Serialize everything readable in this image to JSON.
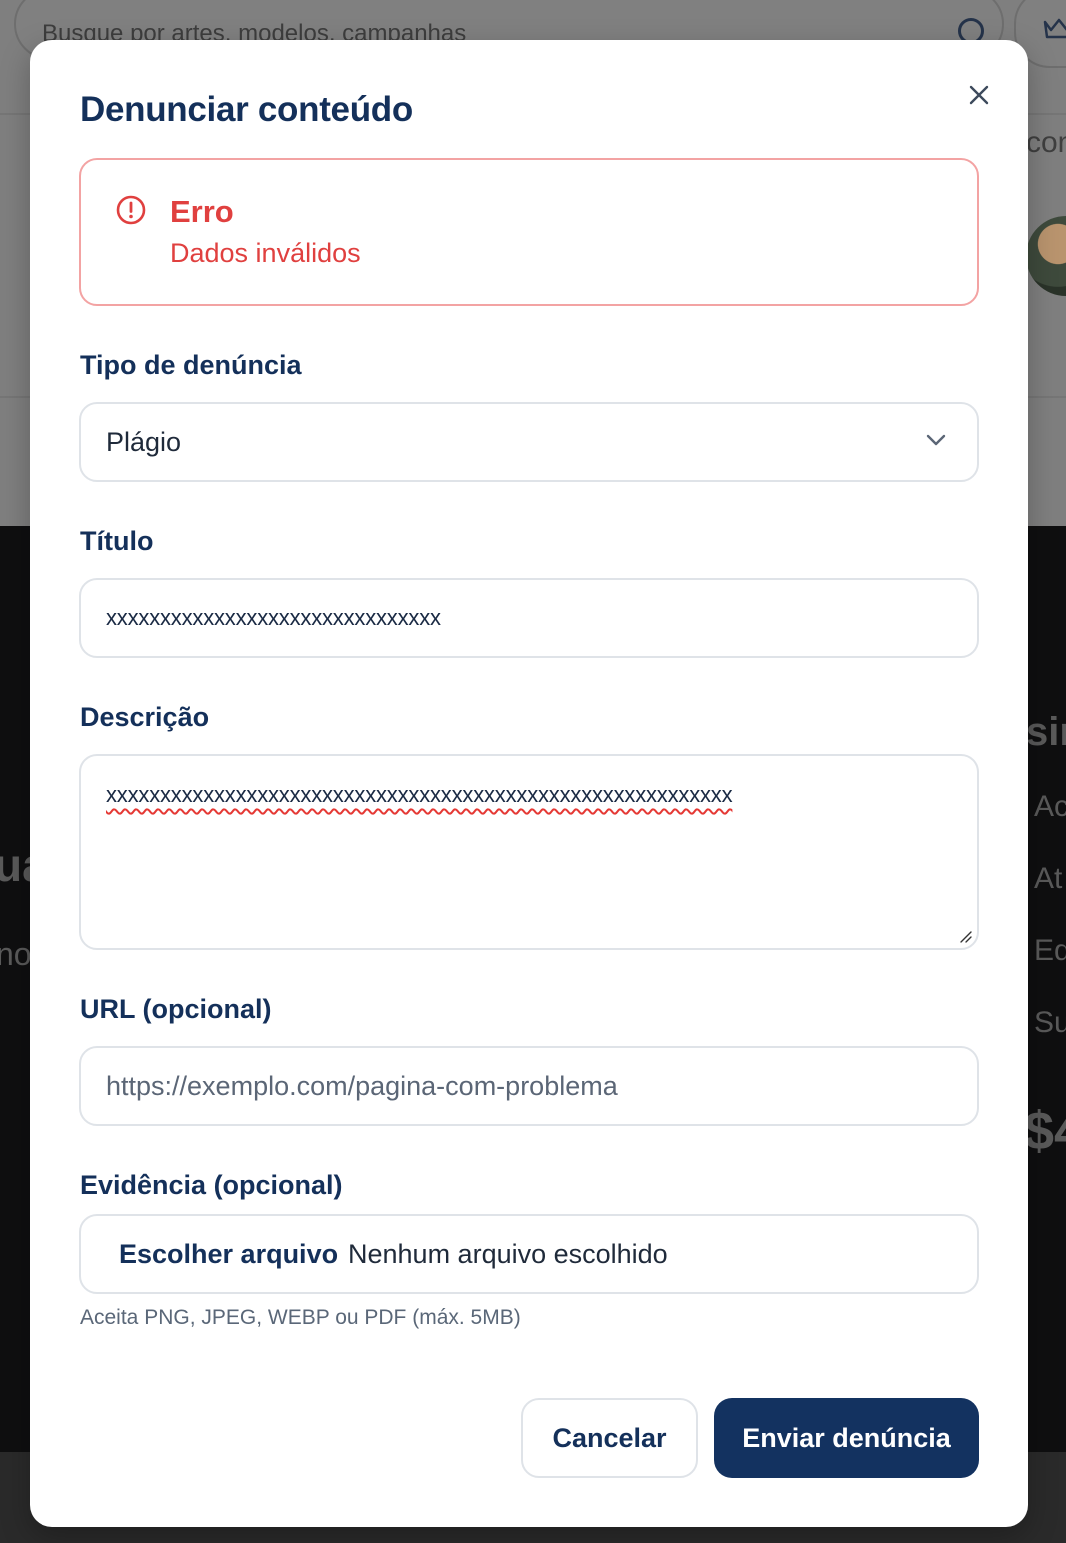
{
  "background": {
    "search_placeholder": "Busque por artes, modelos, campanhas",
    "fragments": {
      "top_right": "com",
      "heading_right": "sin",
      "left_heading": "ua",
      "left_text": "no",
      "list_1": "Ac",
      "list_2": "At",
      "list_3": "Ed",
      "list_4": "Su",
      "price": "$4"
    }
  },
  "modal": {
    "title": "Denunciar conteúdo",
    "close_icon": "close-icon",
    "error": {
      "icon": "alert-circle-icon",
      "title": "Erro",
      "message": "Dados inválidos",
      "color": "#e0403f"
    },
    "type_field": {
      "label": "Tipo de denúncia",
      "value": "Plágio"
    },
    "title_field": {
      "label": "Título",
      "value": "xxxxxxxxxxxxxxxxxxxxxxxxxxxxxxx"
    },
    "description_field": {
      "label": "Descrição",
      "value": "xxxxxxxxxxxxxxxxxxxxxxxxxxxxxxxxxxxxxxxxxxxxxxxxxxxxxxxxxx"
    },
    "url_field": {
      "label": "URL (opcional)",
      "placeholder": "https://exemplo.com/pagina-com-problema"
    },
    "evidence_field": {
      "label": "Evidência (opcional)",
      "button_label": "Escolher arquivo",
      "status": "Nenhum arquivo escolhido",
      "hint": "Aceita PNG, JPEG, WEBP ou PDF (máx. 5MB)"
    },
    "actions": {
      "cancel_label": "Cancelar",
      "submit_label": "Enviar denúncia",
      "primary_color": "#133260"
    }
  }
}
